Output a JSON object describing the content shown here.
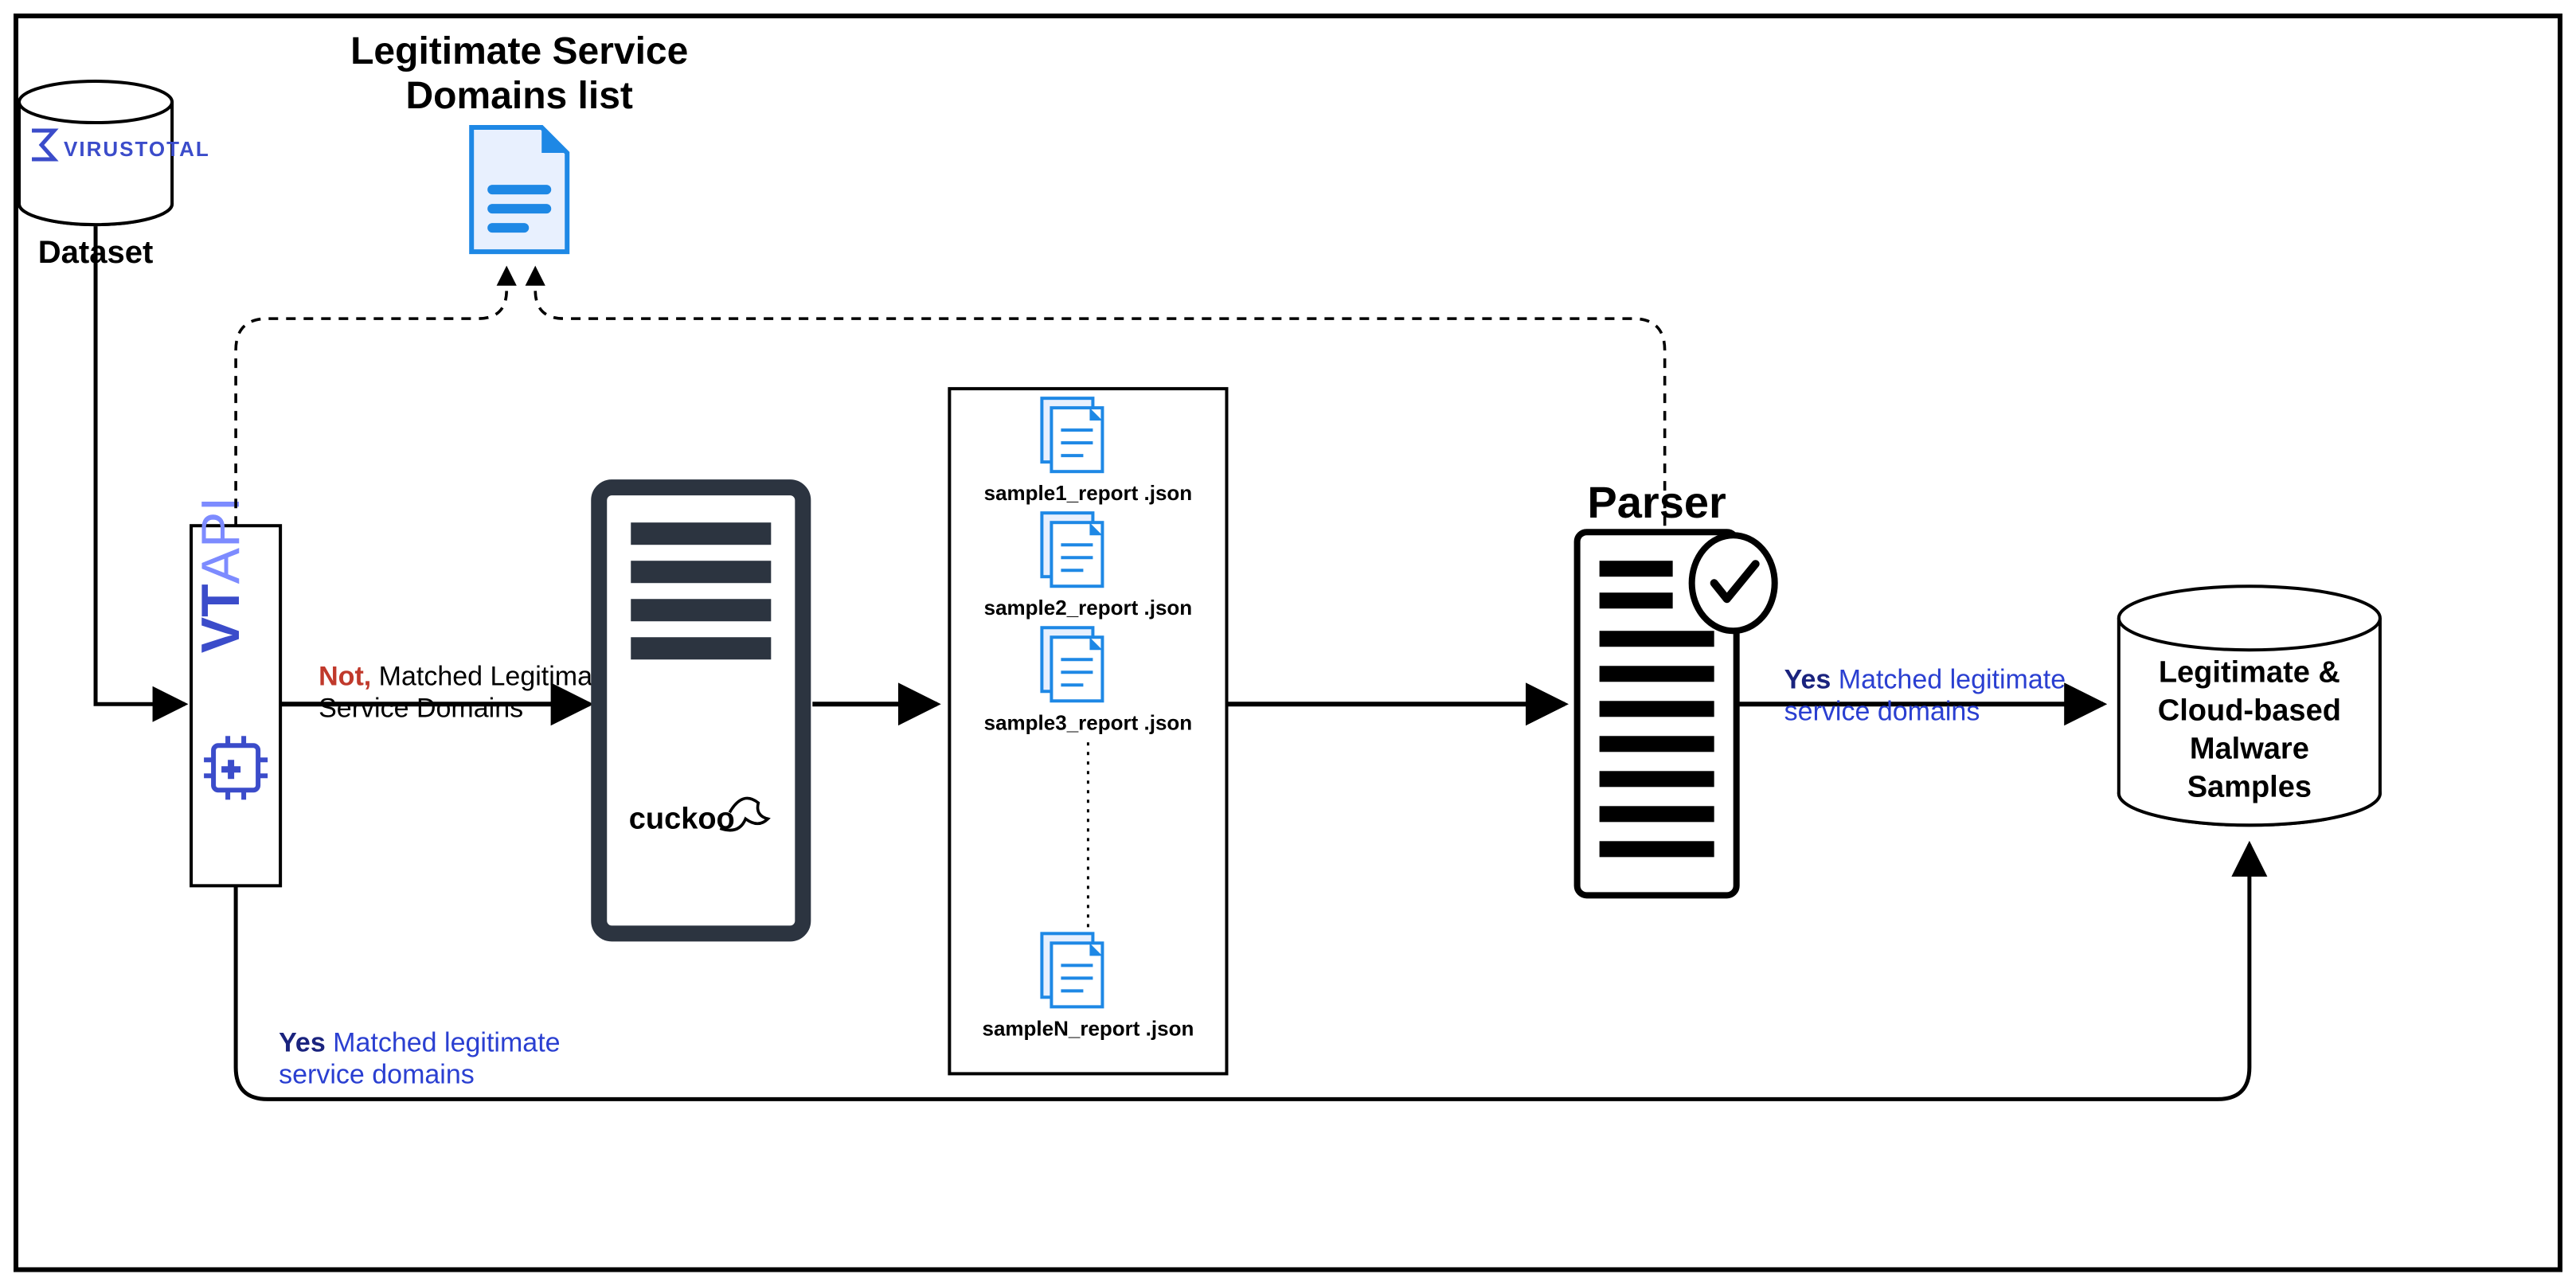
{
  "diagram": {
    "nodes": {
      "dataset": {
        "brand": "VIRUSTOTAL",
        "label": "Dataset"
      },
      "vtapi": {
        "label": "VTAPI"
      },
      "domains_list": {
        "title_line1": "Legitimate Service",
        "title_line2": "Domains list"
      },
      "cuckoo": {
        "label": "cuckoo"
      },
      "reports": {
        "r1": "sample1_report .json",
        "r2": "sample2_report .json",
        "r3": "sample3_report .json",
        "rN": "sampleN_report .json"
      },
      "parser": {
        "title": "Parser"
      },
      "output": {
        "line1": "Legitimate &",
        "line2": "Cloud-based",
        "line3": "Malware",
        "line4": "Samples"
      }
    },
    "edges": {
      "vtapi_to_cuckoo": {
        "prefix": "Not,",
        "text_line1": " Matched Legitimate",
        "text_line2": "Service Domains",
        "prefix_color": "#c0392b",
        "text_color": "#000"
      },
      "vtapi_to_output": {
        "prefix": "Yes",
        "text_line1": " Matched legitimate",
        "text_line2": "service domains",
        "prefix_color": "#1a237e",
        "text_color": "#2a3fd1"
      },
      "parser_to_output": {
        "prefix": "Yes",
        "text_line1": " Matched legitimate",
        "text_line2": "service domains",
        "prefix_color": "#1a237e",
        "text_color": "#2a3fd1"
      }
    }
  }
}
